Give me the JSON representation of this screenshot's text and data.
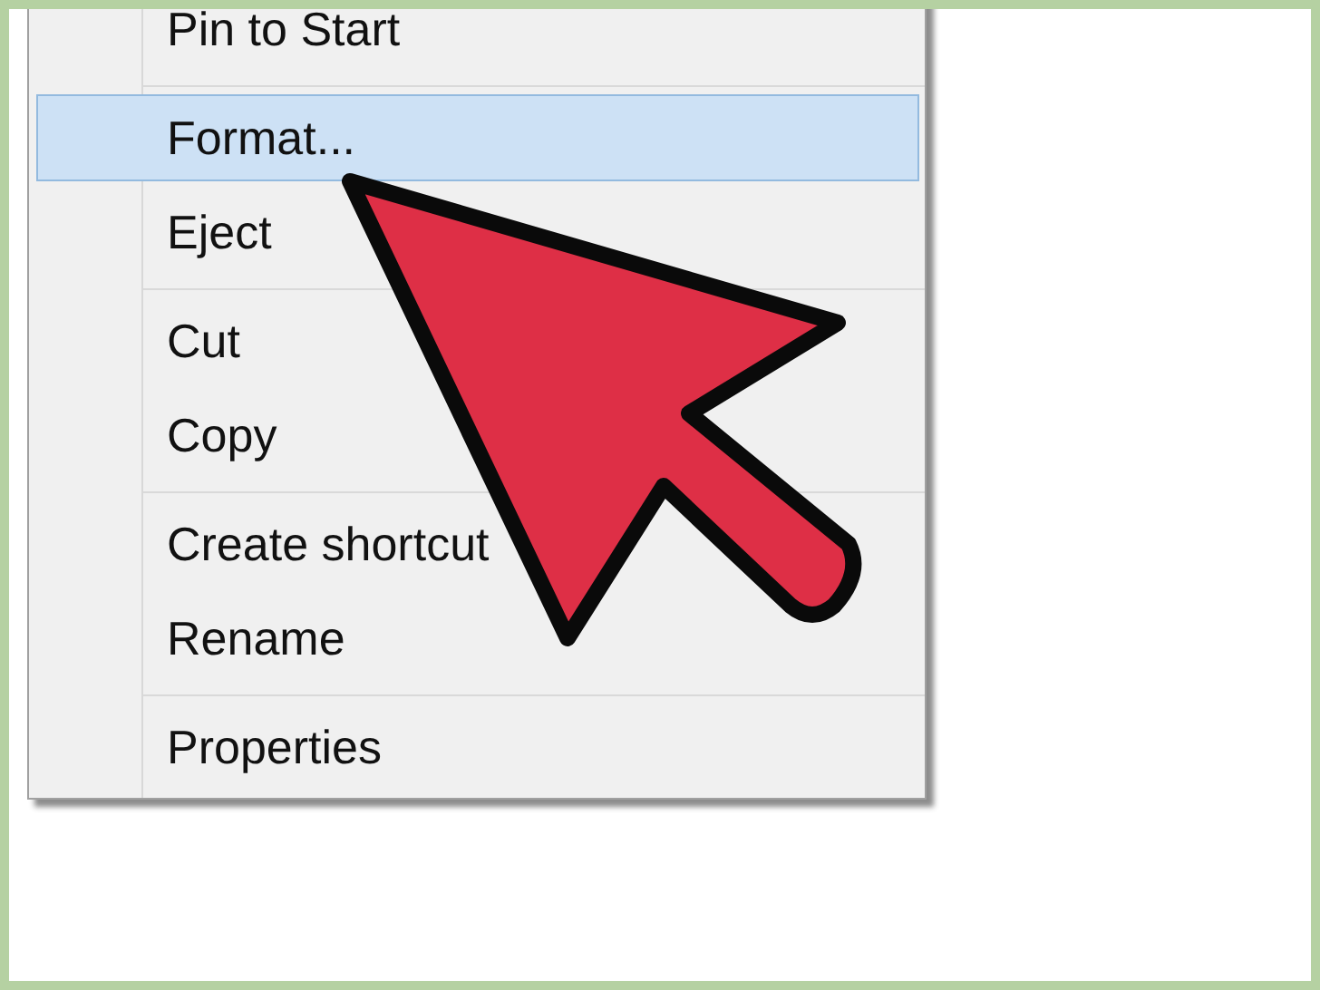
{
  "context_menu": {
    "items": [
      {
        "kind": "item",
        "label": "Pin to Start",
        "selected": false
      },
      {
        "kind": "separator"
      },
      {
        "kind": "item",
        "label": "Format...",
        "selected": true
      },
      {
        "kind": "item",
        "label": "Eject",
        "selected": false
      },
      {
        "kind": "separator"
      },
      {
        "kind": "item",
        "label": "Cut",
        "selected": false
      },
      {
        "kind": "item",
        "label": "Copy",
        "selected": false
      },
      {
        "kind": "separator"
      },
      {
        "kind": "item",
        "label": "Create shortcut",
        "selected": false
      },
      {
        "kind": "item",
        "label": "Rename",
        "selected": false
      },
      {
        "kind": "separator"
      },
      {
        "kind": "item",
        "label": "Properties",
        "selected": false
      }
    ]
  },
  "annotation": {
    "kind": "arrow"
  }
}
